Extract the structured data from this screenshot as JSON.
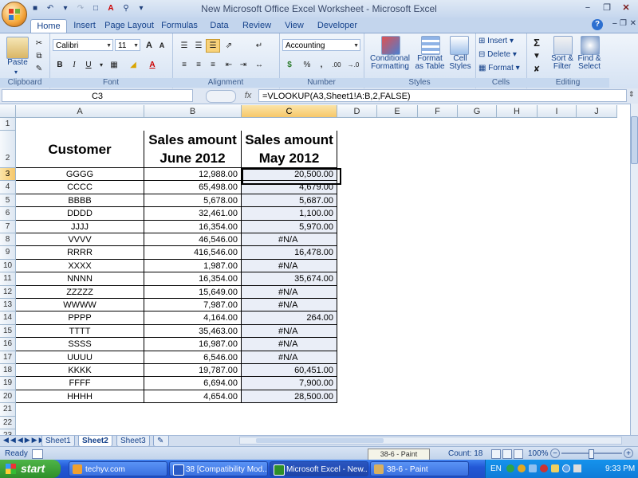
{
  "window": {
    "title": "New Microsoft Office Excel Worksheet - Microsoft Excel",
    "minimize": "−",
    "restore": "❐",
    "close": "✕"
  },
  "ribbon": {
    "tabs": [
      "Home",
      "Insert",
      "Page Layout",
      "Formulas",
      "Data",
      "Review",
      "View",
      "Developer"
    ],
    "active_tab": "Home",
    "clipboard": {
      "label": "Clipboard",
      "paste": "Paste"
    },
    "font": {
      "label": "Font",
      "name": "Calibri",
      "size": "11",
      "bold": "B",
      "italic": "I",
      "underline": "U",
      "grow": "A",
      "shrink": "A",
      "color": "A"
    },
    "alignment": {
      "label": "Alignment"
    },
    "number": {
      "label": "Number",
      "format": "Accounting",
      "currency": "$",
      "percent": "%",
      "comma": ",",
      "inc_dec": ".00",
      "dec_dec": "→.0"
    },
    "styles": {
      "label": "Styles",
      "conditional": [
        "Conditional",
        "Formatting"
      ],
      "format_table": [
        "Format",
        "as Table"
      ],
      "cell_styles": [
        "Cell",
        "Styles"
      ]
    },
    "cells": {
      "label": "Cells",
      "insert": "Insert",
      "delete": "Delete",
      "format": "Format"
    },
    "editing": {
      "label": "Editing",
      "sort": [
        "Sort &",
        "Filter"
      ],
      "find": [
        "Find &",
        "Select"
      ],
      "sigma": "Σ"
    }
  },
  "formula_bar": {
    "name_box": "C3",
    "fx": "fx",
    "formula": "=VLOOKUP(A3,Sheet1!A:B,2,FALSE)"
  },
  "columns": [
    "A",
    "B",
    "C",
    "D",
    "E",
    "F",
    "G",
    "H",
    "I",
    "J"
  ],
  "selected_column": "C",
  "rows": [
    "1",
    "2",
    "3",
    "4",
    "5",
    "6",
    "7",
    "8",
    "9",
    "10",
    "11",
    "12",
    "13",
    "14",
    "15",
    "16",
    "17",
    "18",
    "19",
    "20",
    "21",
    "22",
    "23"
  ],
  "table": {
    "headers": {
      "customer": "Customer",
      "june": [
        "Sales amount",
        "June 2012"
      ],
      "may": [
        "Sales amount",
        "May 2012"
      ]
    },
    "rows": [
      [
        "GGGG",
        "12,988.00",
        "20,500.00"
      ],
      [
        "CCCC",
        "65,498.00",
        "4,679.00"
      ],
      [
        "BBBB",
        "5,678.00",
        "5,687.00"
      ],
      [
        "DDDD",
        "32,461.00",
        "1,100.00"
      ],
      [
        "JJJJ",
        "16,354.00",
        "5,970.00"
      ],
      [
        "VVVV",
        "46,546.00",
        "#N/A"
      ],
      [
        "RRRR",
        "416,546.00",
        "16,478.00"
      ],
      [
        "XXXX",
        "1,987.00",
        "#N/A"
      ],
      [
        "NNNN",
        "16,354.00",
        "35,674.00"
      ],
      [
        "ZZZZZ",
        "15,649.00",
        "#N/A"
      ],
      [
        "WWWW",
        "7,987.00",
        "#N/A"
      ],
      [
        "PPPP",
        "4,164.00",
        "264.00"
      ],
      [
        "TTTT",
        "35,463.00",
        "#N/A"
      ],
      [
        "SSSS",
        "16,987.00",
        "#N/A"
      ],
      [
        "UUUU",
        "6,546.00",
        "#N/A"
      ],
      [
        "KKKK",
        "19,787.00",
        "60,451.00"
      ],
      [
        "FFFF",
        "6,694.00",
        "7,900.00"
      ],
      [
        "HHHH",
        "4,654.00",
        "28,500.00"
      ]
    ]
  },
  "sheets": [
    "Sheet1",
    "Sheet2",
    "Sheet3"
  ],
  "active_sheet": "Sheet2",
  "status": {
    "mode": "Ready",
    "count": "Count: 18",
    "zoom": "100%"
  },
  "tooltip": "38-6 - Paint",
  "taskbar": {
    "start": "start",
    "items": [
      "techyv.com",
      "38 [Compatibility Mod...",
      "Microsoft Excel - New...",
      "38-6 - Paint"
    ],
    "lang": "EN",
    "clock": "9:33 PM"
  },
  "colors": {
    "accent": "#15428b",
    "selection": "#f6c76a",
    "taskbar": "#2358d6",
    "start": "#2e8f2a"
  }
}
